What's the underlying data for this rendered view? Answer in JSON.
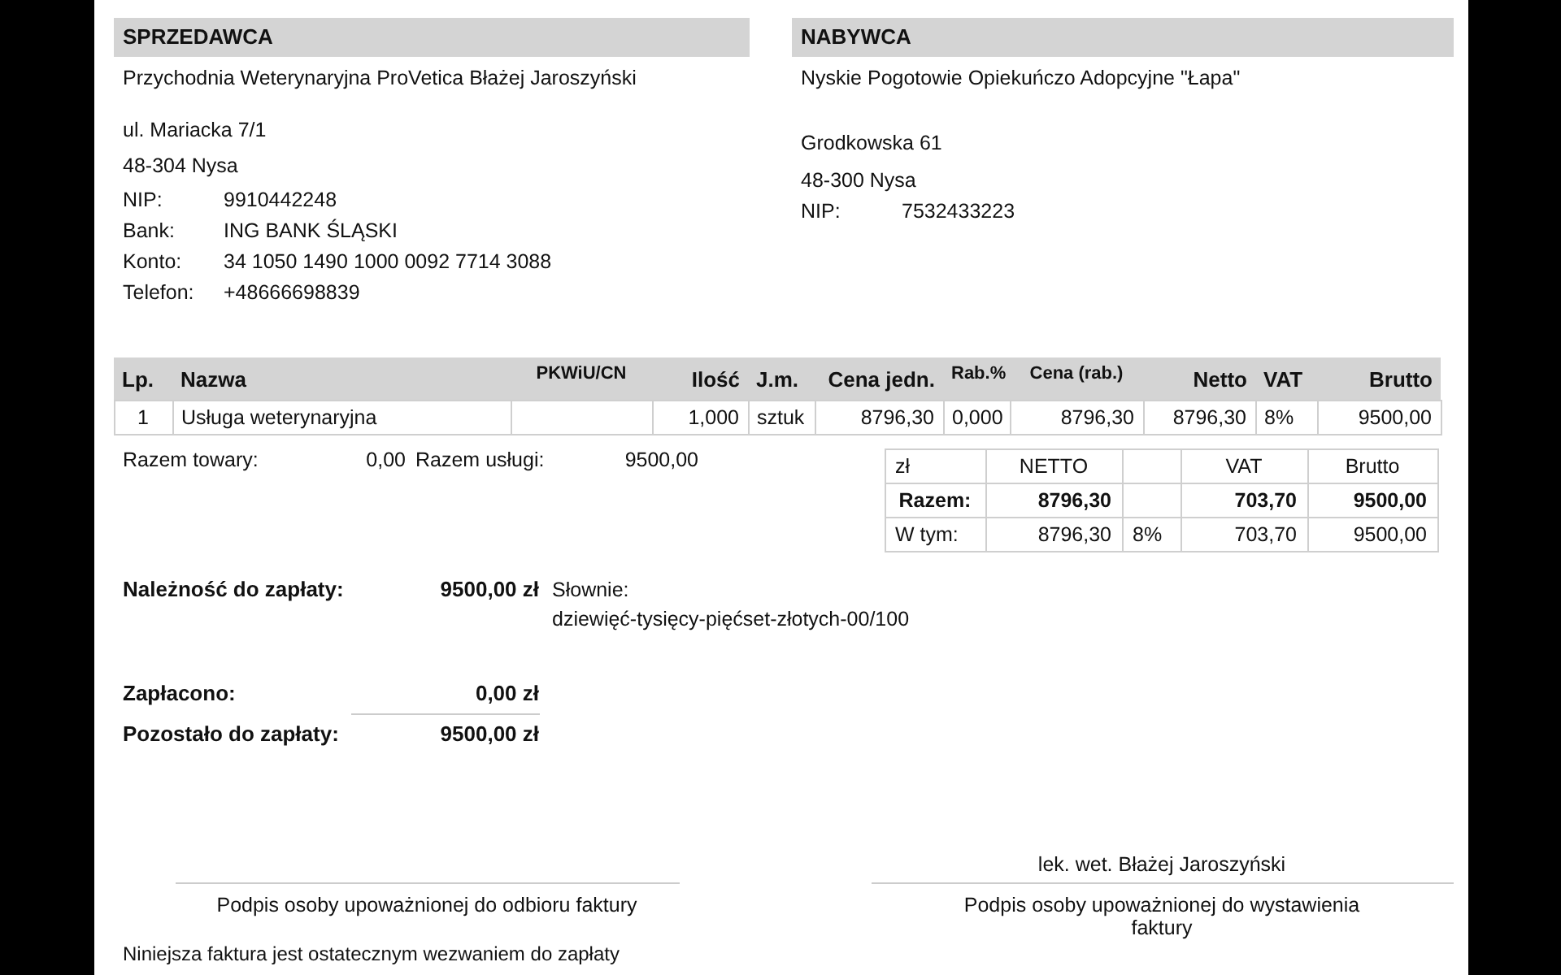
{
  "seller": {
    "heading": "SPRZEDAWCA",
    "name": "Przychodnia Weterynaryjna ProVetica Błażej Jaroszyński",
    "address_lines": [
      "ul. Mariacka 7/1",
      "48-304 Nysa"
    ],
    "details": [
      {
        "label": "NIP:",
        "value": "9910442248"
      },
      {
        "label": "Bank:",
        "value": "ING BANK ŚLĄSKI"
      },
      {
        "label": "Konto:",
        "value": "34 1050 1490 1000 0092 7714 3088"
      },
      {
        "label": "Telefon:",
        "value": "+48666698839"
      }
    ]
  },
  "buyer": {
    "heading": "NABYWCA",
    "name": "Nyskie Pogotowie Opiekuńczo Adopcyjne \"Łapa\"",
    "address_lines": [
      "Grodkowska 61",
      "48-300 Nysa"
    ],
    "details": [
      {
        "label": "NIP:",
        "value": "7532433223"
      }
    ]
  },
  "items_table": {
    "columns": [
      "Lp.",
      "Nazwa",
      "PKWiU/CN",
      "Ilość",
      "J.m.",
      "Cena jedn.",
      "Rab.%",
      "Cena (rab.)",
      "Netto",
      "VAT",
      "Brutto"
    ],
    "rows": [
      {
        "cells": [
          "1",
          "Usługa weterynaryjna",
          null,
          "1,000",
          "sztuk",
          "8796,30",
          "0,000",
          "8796,30",
          "8796,30",
          "8%",
          "9500,00"
        ]
      }
    ]
  },
  "subtotals": [
    {
      "label": "Razem towary:",
      "value": "0,00"
    },
    {
      "label": "Razem usługi:",
      "value": "9500,00"
    }
  ],
  "vat_summary": {
    "header": {
      "currency": "zł",
      "net": "NETTO",
      "vat": "VAT",
      "gross": "Brutto"
    },
    "rows": [
      {
        "kind": "total",
        "cells": [
          "Razem:",
          "8796,30",
          null,
          "703,70",
          "9500,00"
        ]
      },
      {
        "kind": "breakdown",
        "cells": [
          "W tym:",
          "8796,30",
          "8%",
          "703,70",
          "9500,00"
        ]
      }
    ]
  },
  "amount_due": {
    "label": "Należność do zapłaty:",
    "value": "9500,00 zł"
  },
  "in_words": {
    "label": "Słownie:",
    "text": "dziewięć-tysięcy-pięćset-złotych-00/100"
  },
  "paid": {
    "label": "Zapłacono:",
    "value": "0,00 zł"
  },
  "remaining": {
    "label": "Pozostało do zapłaty:",
    "value": "9500,00 zł"
  },
  "signatures": [
    {
      "caption": "Podpis osoby upoważnionej do odbioru faktury"
    },
    {
      "signer": "lek. wet. Błażej Jaroszyński",
      "caption": "Podpis osoby upoważnionej do wystawienia faktury"
    }
  ],
  "footer_note": "Niniejsza faktura jest ostatecznym wezwaniem do zapłaty"
}
